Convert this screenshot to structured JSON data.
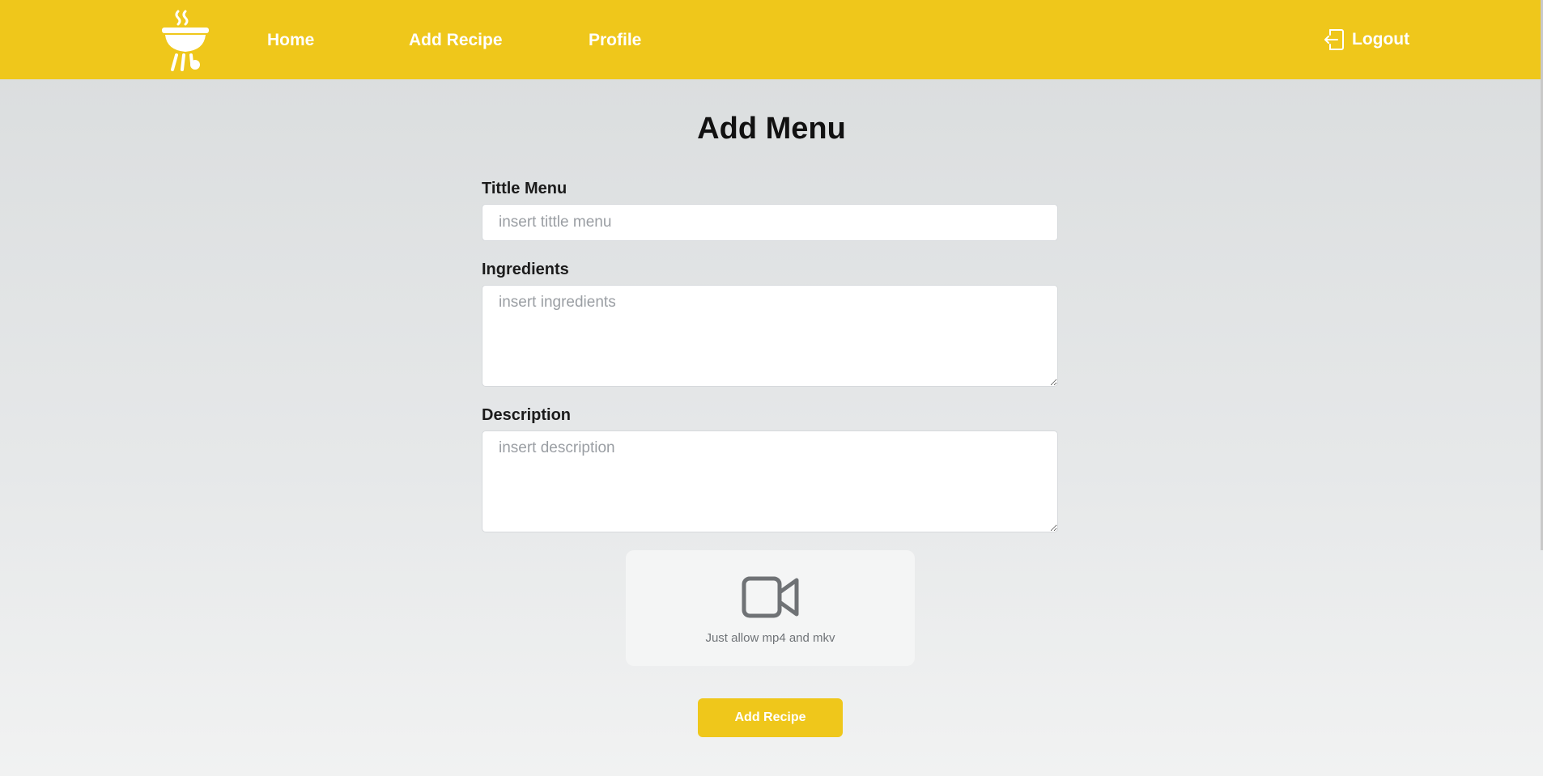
{
  "colors": {
    "brand": "#efc71b",
    "nav_text": "#ffffff",
    "background": "#e3e5e6"
  },
  "navbar": {
    "logo_icon": "barbecue-grill-icon",
    "links": [
      {
        "label": "Home"
      },
      {
        "label": "Add Recipe"
      },
      {
        "label": "Profile"
      }
    ],
    "logout": {
      "icon": "logout-door-icon",
      "label": "Logout"
    }
  },
  "form": {
    "title": "Add Menu",
    "title_field": {
      "label": "Tittle Menu",
      "placeholder": "insert tittle menu",
      "value": ""
    },
    "ingredients_field": {
      "label": "Ingredients",
      "placeholder": "insert ingredients",
      "value": ""
    },
    "description_field": {
      "label": "Description",
      "placeholder": "insert description",
      "value": ""
    },
    "video_upload": {
      "icon": "video-camera-icon",
      "hint": "Just allow mp4 and mkv"
    },
    "submit_label": "Add Recipe"
  }
}
